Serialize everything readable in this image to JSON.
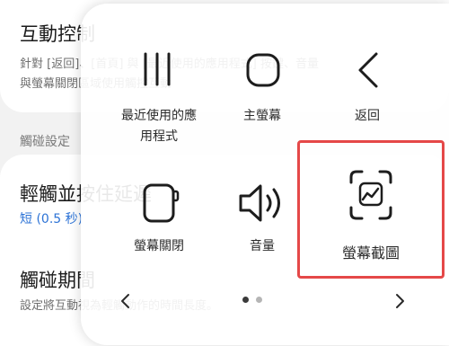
{
  "background": {
    "interaction_control": {
      "title": "互動控制",
      "desc_line1": "針對 [返回]、[首頁] 與 [最近使用的應用程式] 按鍵、音量",
      "desc_line2": "與螢幕關閉區域使用觸控互動"
    },
    "touch_settings_section": "觸碰設定",
    "touch_hold_delay": {
      "title": "輕觸並按住延遲",
      "value": "短 (0.5 秒)"
    },
    "tap_duration": {
      "title": "觸碰期間",
      "desc": "設定將互動視為輕觸動作的時間長度。"
    }
  },
  "panel": {
    "tiles": [
      {
        "id": "recents",
        "label_line1": "最近使用的應",
        "label_line2": "用程式",
        "icon": "recents-icon"
      },
      {
        "id": "home",
        "label_line1": "主螢幕",
        "icon": "home-icon"
      },
      {
        "id": "back",
        "label_line1": "返回",
        "icon": "back-icon"
      },
      {
        "id": "screen-off",
        "label_line1": "螢幕關閉",
        "icon": "screen-off-icon"
      },
      {
        "id": "volume",
        "label_line1": "音量",
        "icon": "volume-icon"
      },
      {
        "id": "screenshot",
        "label_line1": "螢幕截圖",
        "icon": "screenshot-icon"
      }
    ],
    "page_count": 2,
    "current_page": 1
  },
  "colors": {
    "highlight": "#e54848",
    "accent_blue": "#2d73d6"
  }
}
